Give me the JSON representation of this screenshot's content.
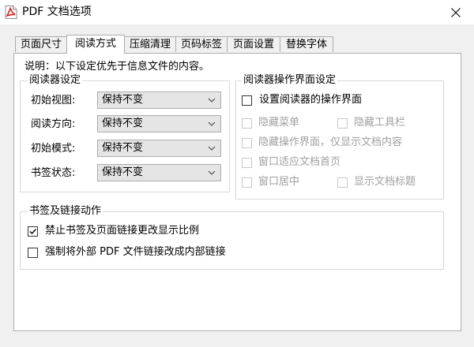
{
  "window": {
    "title": "PDF 文档选项",
    "icon": "pdf-file-icon",
    "close_icon": "close-icon"
  },
  "tabs": [
    {
      "label": "页面尺寸",
      "active": false
    },
    {
      "label": "阅读方式",
      "active": true
    },
    {
      "label": "压缩清理",
      "active": false
    },
    {
      "label": "页码标签",
      "active": false
    },
    {
      "label": "页面设置",
      "active": false
    },
    {
      "label": "替换字体",
      "active": false
    }
  ],
  "note": "说明：以下设定优先于信息文件的内容。",
  "reader_settings": {
    "title": "阅读器设定",
    "fields": [
      {
        "label": "初始视图:",
        "value": "保持不变"
      },
      {
        "label": "阅读方向:",
        "value": "保持不变"
      },
      {
        "label": "初始模式:",
        "value": "保持不变"
      },
      {
        "label": "书签状态:",
        "value": "保持不变"
      }
    ]
  },
  "reader_ui": {
    "title": "阅读器操作界面设定",
    "set_ui": {
      "label": "设置阅读器的操作界面",
      "checked": false
    },
    "options": [
      {
        "label": "隐藏菜单",
        "checked": false,
        "enabled": false
      },
      {
        "label": "隐藏工具栏",
        "checked": false,
        "enabled": false
      },
      {
        "label": "隐藏操作界面，仅显示文档内容",
        "checked": false,
        "enabled": false
      },
      {
        "label": "窗口适应文档首页",
        "checked": false,
        "enabled": false
      },
      {
        "label": "窗口居中",
        "checked": false,
        "enabled": false
      },
      {
        "label": "显示文档标题",
        "checked": false,
        "enabled": false
      }
    ]
  },
  "bookmark_actions": {
    "title": "书签及链接动作",
    "options": [
      {
        "label": "禁止书签及页面链接更改显示比例",
        "checked": true
      },
      {
        "label": "强制将外部 PDF 文件链接改成内部链接",
        "checked": false
      }
    ]
  },
  "colors": {
    "border": "#adadad",
    "group_border": "#d8d8d8",
    "disabled_text": "#a0a0a0",
    "pdf_red": "#d9251d"
  }
}
